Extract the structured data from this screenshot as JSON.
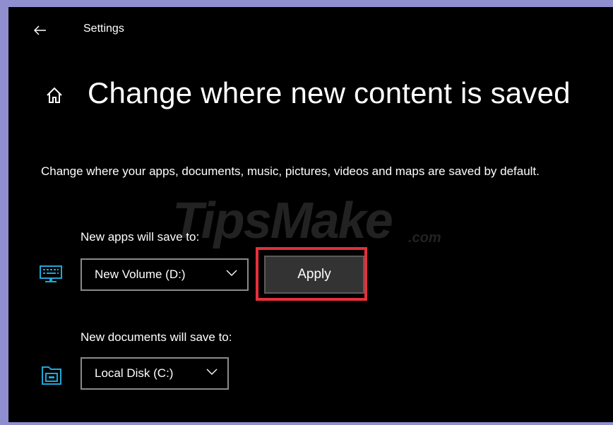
{
  "window": {
    "title": "Settings"
  },
  "page": {
    "title": "Change where new content is saved",
    "description": "Change where your apps, documents, music, pictures, videos and maps are saved by default."
  },
  "apps_section": {
    "label": "New apps will save to:",
    "selected_drive": "New Volume (D:)",
    "apply_label": "Apply"
  },
  "documents_section": {
    "label": "New documents will save to:",
    "selected_drive": "Local Disk (C:)"
  },
  "watermark": {
    "brand": "TipsMake",
    "suffix": ".com"
  },
  "colors": {
    "background": "#000000",
    "accent_icon": "#1ea7d8",
    "highlight_border": "#e5303a",
    "apply_button": "#333333"
  },
  "icons": {
    "back": "back-arrow-icon",
    "home": "home-icon",
    "apps_drive": "monitor-keyboard-icon",
    "documents_drive": "folder-drive-icon",
    "dropdown": "chevron-down-icon"
  }
}
